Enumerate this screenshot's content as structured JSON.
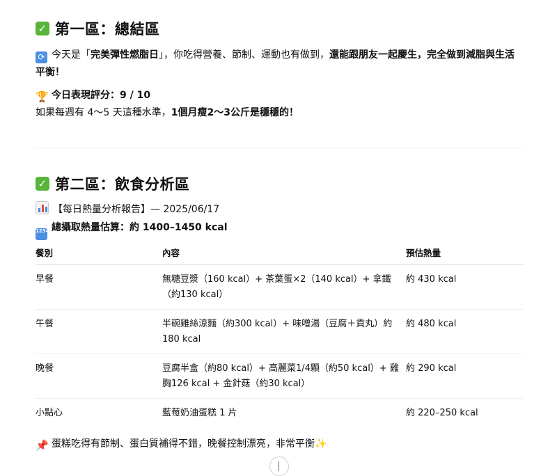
{
  "section1": {
    "title": "第一區：總結區",
    "summary": {
      "plain1": "今天是「",
      "bold1": "完美彈性燃脂日",
      "plain2": "」，你吃得營養、節制、運動也有做到，",
      "bold2": "還能跟朋友一起慶生，完全做到減脂與生活平衡！"
    },
    "score_label": "今日表現評分：9 / 10",
    "forecast": {
      "plain": "如果每週有 4～5 天這種水準，",
      "bold": "1個月瘦2～3公斤是穩穩的！"
    }
  },
  "section2": {
    "title": "第二區：飲食分析區",
    "report_title": "【每日熱量分析報告】— 2025/06/17",
    "total_label": "總攝取熱量估算：約 1400–1450 kcal",
    "table": {
      "headers": [
        "餐別",
        "內容",
        "預估熱量"
      ],
      "rows": [
        {
          "meal": "早餐",
          "content": "無糖豆漿（160 kcal）+ 茶葉蛋×2（140 kcal）+ 拿鐵（約130 kcal）",
          "kcal": "約 430 kcal"
        },
        {
          "meal": "午餐",
          "content": "半碗雞絲涼麵（約300 kcal）+ 味噌湯（豆腐＋貢丸）約180 kcal",
          "kcal": "約 480 kcal"
        },
        {
          "meal": "晚餐",
          "content": "豆腐半盒（約80 kcal）+ 高麗菜1/4顆（約50 kcal）+ 雞胸126 kcal + 金針菇（約30 kcal）",
          "kcal": "約 290 kcal"
        },
        {
          "meal": "小點心",
          "content": "藍莓奶油蛋糕 1 片",
          "kcal": "約 220–250 kcal"
        }
      ]
    },
    "note": "蛋糕吃得有節制、蛋白質補得不錯，晚餐控制漂亮，非常平衡"
  },
  "icons": {
    "check": "✓",
    "repeat": "⟳",
    "trophy": "🏆",
    "numbers": "1234",
    "pin": "📌",
    "sparkle": "✨"
  },
  "colors": {
    "check_green": "#58b43a",
    "emoji_blue": "#4a8fe3"
  }
}
